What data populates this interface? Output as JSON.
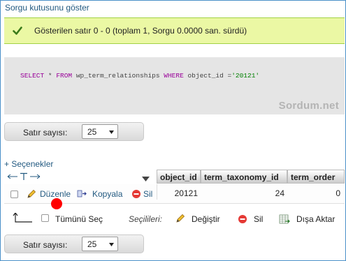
{
  "show_query_link": "Sorgu kutusunu göster",
  "success_message": "Gösterilen satır 0 - 0 (toplam 1, Sorgu 0.0000 san. sürdü)",
  "sql": {
    "k_select": "SELECT",
    "star": " * ",
    "k_from": "FROM",
    "table": " wp_term_relationships ",
    "k_where": "WHERE",
    "cond": " object_id =",
    "value": "'20121'"
  },
  "watermark": "Sordum.net",
  "nav_top": {
    "label": "Satır sayısı:",
    "value": "25"
  },
  "nav_bottom": {
    "label": "Satır sayısı:",
    "value": "25"
  },
  "options_link": "+ Seçenekler",
  "table": {
    "columns": [
      "object_id",
      "term_taxonomy_id",
      "term_order"
    ],
    "row": {
      "actions": [
        "Düzenle",
        "Kopyala",
        "Sil"
      ],
      "cells": [
        "20121",
        "24",
        "0"
      ]
    }
  },
  "bulk": {
    "check_all": "Tümünü Seç",
    "selected_label": "Seçilileri:",
    "change": "Değiştir",
    "delete": "Sil",
    "export": "Dışa Aktar"
  },
  "colors": {
    "success_bg": "#ebf8a4",
    "link": "#235a81",
    "keyword": "#990099",
    "marker": "#ff0000"
  }
}
